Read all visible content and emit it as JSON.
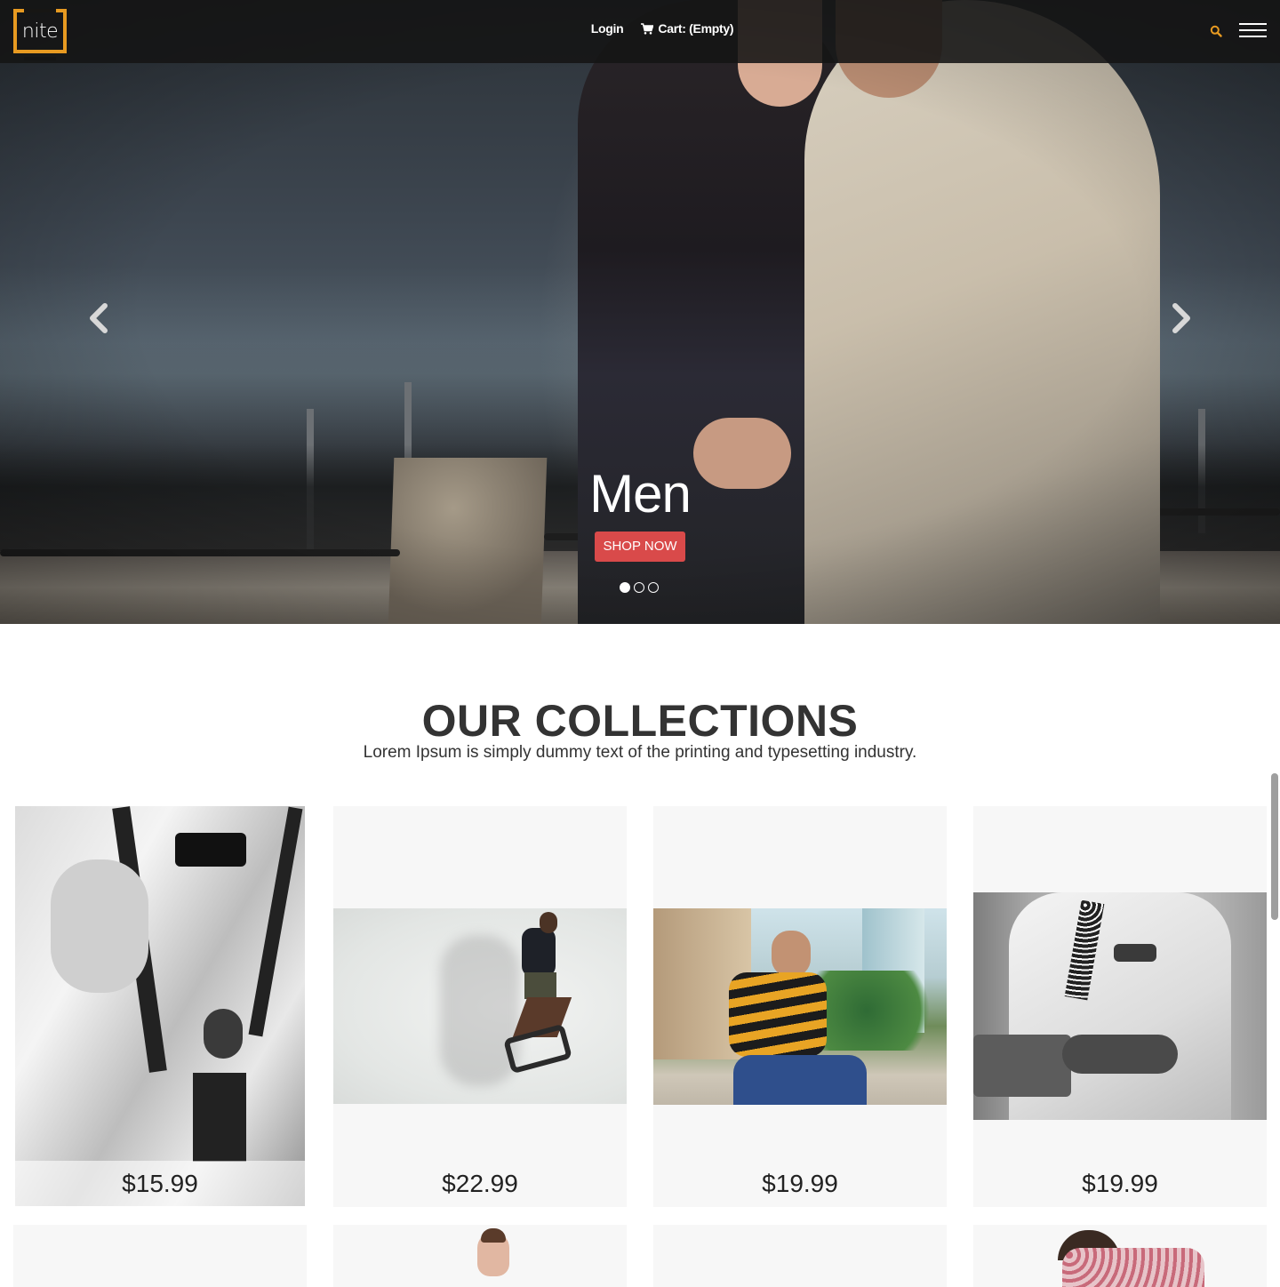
{
  "header": {
    "logo_text": "nite",
    "login_label": "Login",
    "cart_label": "Cart: (Empty)"
  },
  "slider": {
    "title": "Men",
    "cta_label": "SHOP NOW",
    "slide_count": 3,
    "active_slide": 1
  },
  "collections": {
    "title": "OUR COLLECTIONS",
    "subtitle": "Lorem Ipsum is simply dummy text of the printing and typesetting industry.",
    "products": [
      {
        "price": "$15.99"
      },
      {
        "price": "$22.99"
      },
      {
        "price": "$19.99"
      },
      {
        "price": "$19.99"
      }
    ]
  },
  "colors": {
    "brand_accent": "#e79a21",
    "cta_red": "#d94a4a",
    "topbar": "#141414"
  },
  "icons": [
    "search-icon",
    "menu-icon",
    "cart-icon",
    "chevron-left-icon",
    "chevron-right-icon"
  ]
}
